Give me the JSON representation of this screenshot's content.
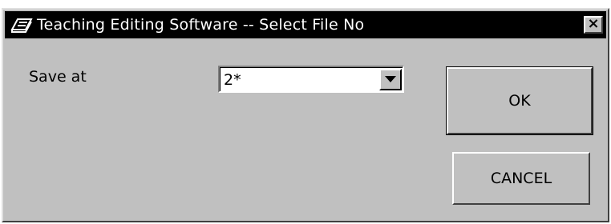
{
  "window": {
    "title": "Teaching Editing Software -- Select File No",
    "close_label": "×"
  },
  "form": {
    "save_label": "Save at",
    "file_no_value": "2*"
  },
  "buttons": {
    "ok_label": "OK",
    "cancel_label": "CANCEL"
  },
  "colors": {
    "dialog_bg": "#c0c0c0",
    "titlebar_bg": "#000000",
    "titlebar_text": "#ffffff"
  },
  "icons": {
    "app": "teaching-pendant-icon",
    "close": "close-icon",
    "dropdown": "chevron-down-icon"
  }
}
